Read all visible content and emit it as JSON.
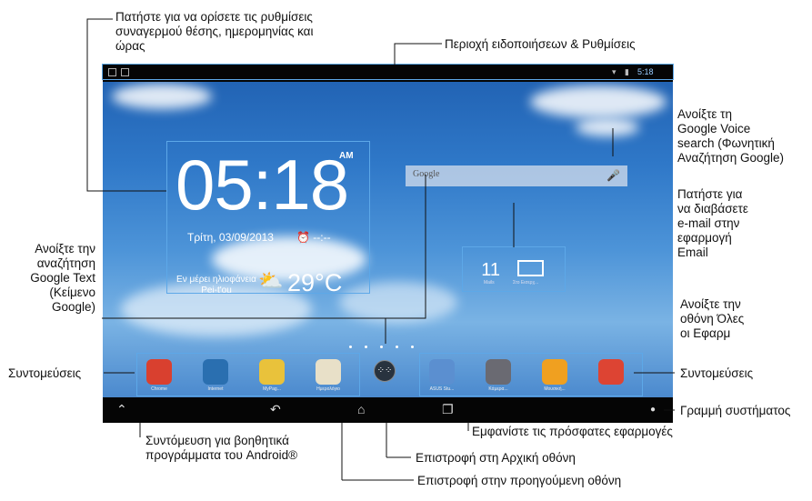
{
  "callouts": {
    "time_settings": "Πατήστε για να ορίσετε τις ρυθμίσεις",
    "time_settings_2": "συναγερμού θέσης, ημερομηνίας και",
    "time_settings_3": "ώρας",
    "notifications": "Περιοχή ειδοποιήσεων & Ρυθμίσεις",
    "voice_1": "Ανοίξτε τη",
    "voice_2": "Google Voice",
    "voice_3": "search (Φωνητική",
    "voice_4": "Αναζήτηση Google)",
    "email_1": "Πατήστε για",
    "email_2": "να διαβάσετε",
    "email_3": "e-mail στην",
    "email_4": "εφαρμογή",
    "email_5": "Email",
    "text_search_1": "Ανοίξτε την",
    "text_search_2": "αναζήτηση",
    "text_search_3": "Google Text",
    "text_search_4": "(Κείμενο",
    "text_search_5": "Google)",
    "all_apps_1": "Ανοίξτε την",
    "all_apps_2": "οθόνη Όλες",
    "all_apps_3": "οι Εφαρμ",
    "shortcuts_left": "Συντομεύσεις",
    "shortcuts_right": "Συντομεύσεις",
    "system_bar": "Γραμμή συστήματος",
    "recent_apps": "Εμφανίστε τις πρόσφατες εφαρμογές",
    "android_tools_1": "Συντόμευση για βοηθητικά",
    "android_tools_2": "προγράμματα του Android®",
    "home": "Επιστροφή στη Αρχική οθόνη",
    "back": "Επιστροφή στην προηγούμενη οθόνη"
  },
  "statusbar": {
    "time": "5:18"
  },
  "clock": {
    "time": "05:18",
    "ampm": "AM",
    "date": "Τρίτη, 03/09/2013",
    "alarm": "--:--",
    "weather_desc_1": "Εν μέρει ηλιοφάνεια",
    "weather_desc_2": "Pei-t'ou",
    "temperature": "29°C"
  },
  "search": {
    "label": "Google"
  },
  "email": {
    "count": "11",
    "label_left": "Mails",
    "label_right": "Στο Εισερχ..."
  },
  "dock_left": [
    {
      "label": "Chrome",
      "color": "#d9402f"
    },
    {
      "label": "Internet",
      "color": "#2a6fb0"
    },
    {
      "label": "MyPag...",
      "color": "#e9c23b"
    },
    {
      "label": "Ημερολόγιο",
      "color": "#e8e0c8"
    }
  ],
  "dock_right": [
    {
      "label": "ASUS Stu...",
      "color": "#5b8fd0"
    },
    {
      "label": "Κάμερα...",
      "color": "#6a6a72"
    },
    {
      "label": "Μουσική...",
      "color": "#f0a020"
    },
    {
      "label": "",
      "color": "#dd4433"
    }
  ],
  "all_apps_icon": "grid-icon"
}
